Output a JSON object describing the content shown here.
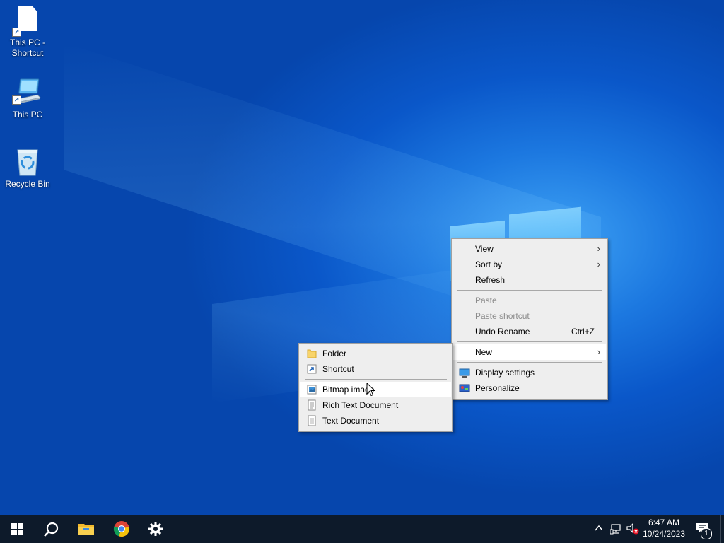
{
  "desktop": {
    "icons": [
      {
        "label": "This PC - Shortcut"
      },
      {
        "label": "This PC"
      },
      {
        "label": "Recycle Bin"
      }
    ]
  },
  "context_menu": {
    "items": {
      "view": "View",
      "sort_by": "Sort by",
      "refresh": "Refresh",
      "paste": "Paste",
      "paste_shortcut": "Paste shortcut",
      "undo_rename": "Undo Rename",
      "undo_rename_shortcut": "Ctrl+Z",
      "new": "New",
      "display_settings": "Display settings",
      "personalize": "Personalize"
    }
  },
  "new_submenu": {
    "items": {
      "folder": "Folder",
      "shortcut": "Shortcut",
      "bitmap_image": "Bitmap image",
      "rich_text_document": "Rich Text Document",
      "text_document": "Text Document"
    }
  },
  "taskbar": {
    "clock": {
      "time": "6:47 AM",
      "date": "10/24/2023"
    },
    "notification_count": "1",
    "accent": "#0078d7"
  }
}
